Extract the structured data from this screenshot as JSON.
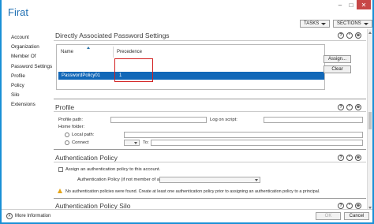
{
  "window": {
    "title": "Firat",
    "controls": {
      "minimize": "–",
      "maximize": "□",
      "close": "✕"
    }
  },
  "header": {
    "tasks_label": "TASKS",
    "sections_label": "SECTIONS"
  },
  "nav": {
    "items": [
      {
        "label": "Account"
      },
      {
        "label": "Organization"
      },
      {
        "label": "Member Of"
      },
      {
        "label": "Password Settings"
      },
      {
        "label": "Profile"
      },
      {
        "label": "Policy"
      },
      {
        "label": "Silo"
      },
      {
        "label": "Extensions"
      }
    ]
  },
  "password_settings": {
    "title": "Directly Associated Password Settings",
    "columns": {
      "name": "Name",
      "precedence": "Precedence"
    },
    "rows": [
      {
        "name": "PasswordPolicy01",
        "precedence": "1"
      }
    ],
    "assign_label": "Assign...",
    "clear_label": "Clear"
  },
  "profile": {
    "title": "Profile",
    "profile_path_label": "Profile path:",
    "profile_path_value": "",
    "logon_script_label": "Log on script:",
    "logon_script_value": "",
    "home_folder_label": "Home folder:",
    "local_path_label": "Local path:",
    "local_path_value": "",
    "connect_label": "Connect",
    "drive_value": "",
    "to_label": "To:",
    "to_value": ""
  },
  "auth_policy": {
    "title": "Authentication Policy",
    "assign_checkbox_label": "Assign an authentication policy to this account.",
    "policy_label": "Authentication Policy (if not member of a Silo):",
    "policy_value": "",
    "warning_text": "No authentication policies were found. Create at least one authentication policy prior to assigning an authentication policy to a principal."
  },
  "auth_silo": {
    "title": "Authentication Policy Silo"
  },
  "footer": {
    "more_info_label": "More Information",
    "ok_label": "OK",
    "cancel_label": "Cancel"
  },
  "icons": {
    "help": "?",
    "collapse": "⌃",
    "collapse_section": "⊕",
    "more_info_chevron": "˄"
  },
  "colors": {
    "accent": "#1a90d6",
    "selection": "#1268b8",
    "highlight_border": "#d21f1f",
    "warning": "#e5a417"
  }
}
